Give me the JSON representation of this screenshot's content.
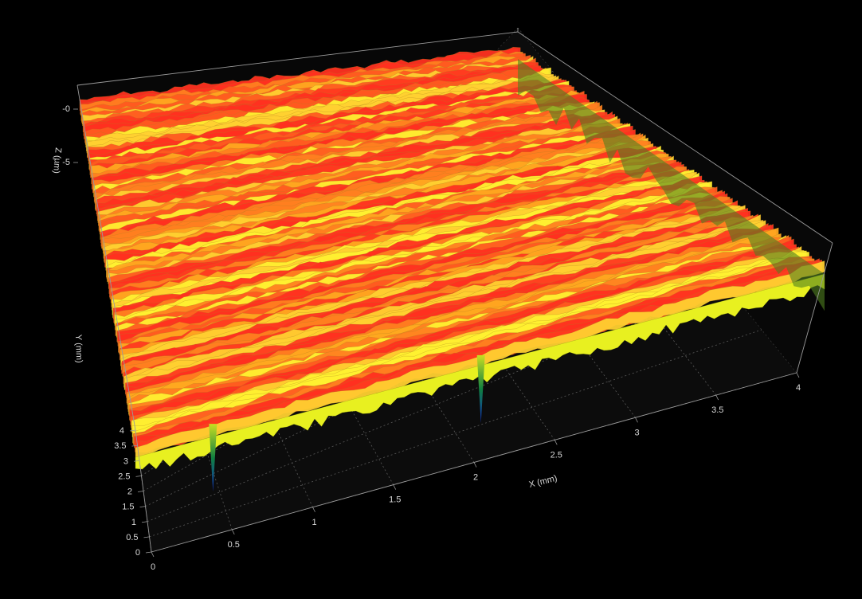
{
  "chart_data": {
    "type": "surface3d",
    "title": "",
    "background": "#000000",
    "xlabel": "X (mm)",
    "ylabel": "Y (mm)",
    "zlabel": "Z (µm)",
    "xlim": [
      0,
      4
    ],
    "ylim": [
      0,
      4
    ],
    "zlim": [
      -5,
      0
    ],
    "x_ticks": [
      "0",
      "0.5",
      "1",
      "1.5",
      "2",
      "2.5",
      "3",
      "3.5",
      "4"
    ],
    "y_ticks": [
      "0",
      "0.5",
      "1",
      "1.5",
      "2",
      "2.5",
      "3",
      "3.5",
      "4"
    ],
    "z_ticks": [
      "-5",
      "-0"
    ],
    "grid": true,
    "colormap": [
      "#1030c0",
      "#108040",
      "#ffff20",
      "#ffa020",
      "#ff3020",
      "#e02070"
    ],
    "features": [
      {
        "description": "deep narrow pit",
        "x": 0.45,
        "y": 0.7,
        "z": -5
      },
      {
        "description": "deep narrow pit",
        "x": 1.95,
        "y": 1.2,
        "z": -5
      }
    ]
  }
}
